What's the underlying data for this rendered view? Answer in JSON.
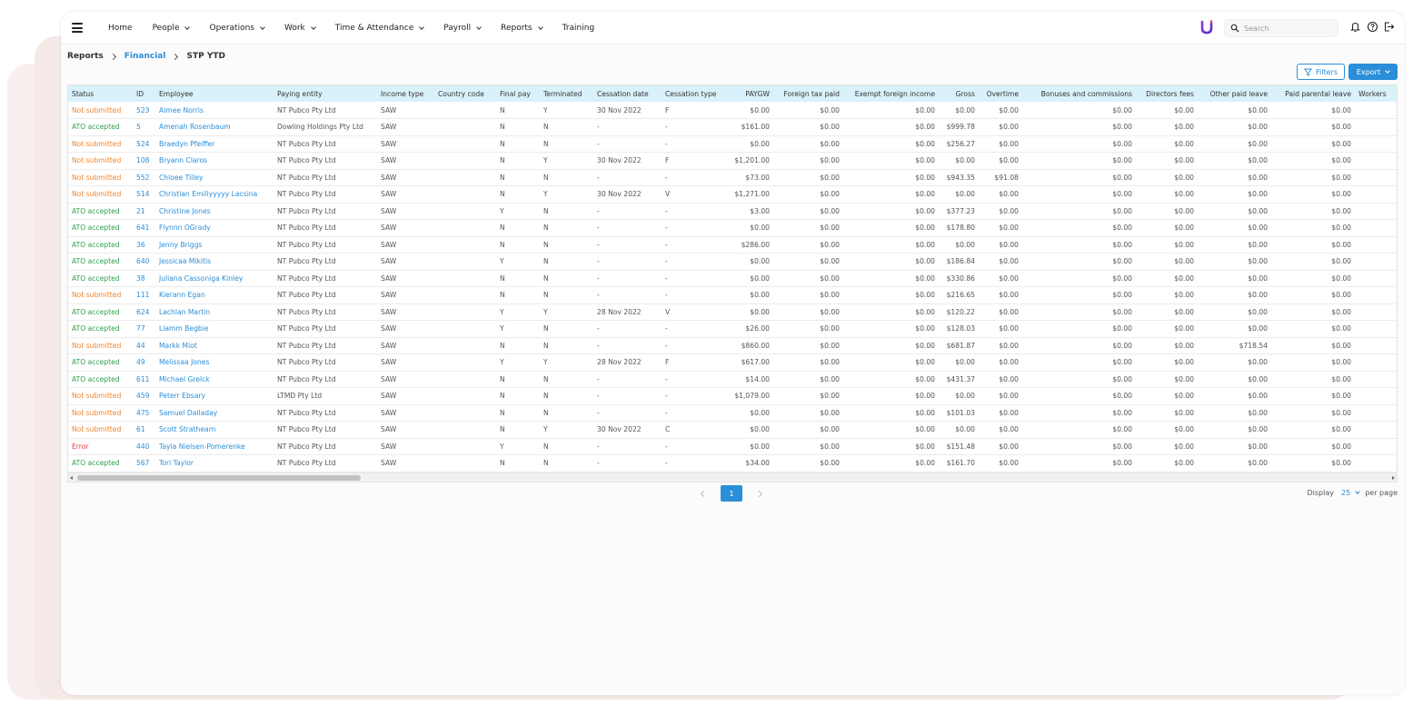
{
  "nav": {
    "menu": [
      {
        "label": "Home",
        "dropdown": false
      },
      {
        "label": "People",
        "dropdown": true
      },
      {
        "label": "Operations",
        "dropdown": true
      },
      {
        "label": "Work",
        "dropdown": true
      },
      {
        "label": "Time & Attendance",
        "dropdown": true
      },
      {
        "label": "Payroll",
        "dropdown": true
      },
      {
        "label": "Reports",
        "dropdown": true
      },
      {
        "label": "Training",
        "dropdown": false
      }
    ],
    "search_placeholder": "Search"
  },
  "breadcrumb": {
    "root": "Reports",
    "section": "Financial",
    "current": "STP YTD"
  },
  "toolbar": {
    "filters_label": "Filters",
    "export_label": "Export"
  },
  "table": {
    "columns": [
      "Status",
      "ID",
      "Employee",
      "Paying entity",
      "Income type",
      "Country code",
      "Final pay",
      "Terminated",
      "Cessation date",
      "Cessation type",
      "PAYGW",
      "Foreign tax paid",
      "Exempt foreign income",
      "Gross",
      "Overtime",
      "Bonuses and commissions",
      "Directors fees",
      "Other paid leave",
      "Paid parental leave",
      "Workers"
    ],
    "rows": [
      [
        "Not submitted",
        "523",
        "Aimee Norris",
        "NT Pubco Pty Ltd",
        "SAW",
        "",
        "N",
        "Y",
        "30 Nov 2022",
        "F",
        "$0.00",
        "$0.00",
        "$0.00",
        "$0.00",
        "$0.00",
        "$0.00",
        "$0.00",
        "$0.00",
        "$0.00",
        ""
      ],
      [
        "ATO accepted",
        "5",
        "Amenah Rosenbaum",
        "Dowling Holdings Pty Ltd",
        "SAW",
        "",
        "N",
        "N",
        "-",
        "-",
        "$161.00",
        "$0.00",
        "$0.00",
        "$999.78",
        "$0.00",
        "$0.00",
        "$0.00",
        "$0.00",
        "$0.00",
        ""
      ],
      [
        "Not submitted",
        "524",
        "Braedyn Pfeiffer",
        "NT Pubco Pty Ltd",
        "SAW",
        "",
        "N",
        "N",
        "-",
        "-",
        "$0.00",
        "$0.00",
        "$0.00",
        "$256.27",
        "$0.00",
        "$0.00",
        "$0.00",
        "$0.00",
        "$0.00",
        ""
      ],
      [
        "Not submitted",
        "108",
        "Bryann Claros",
        "NT Pubco Pty Ltd",
        "SAW",
        "",
        "N",
        "Y",
        "30 Nov 2022",
        "F",
        "$1,201.00",
        "$0.00",
        "$0.00",
        "$0.00",
        "$0.00",
        "$0.00",
        "$0.00",
        "$0.00",
        "$0.00",
        ""
      ],
      [
        "Not submitted",
        "552",
        "Chloee Tilley",
        "NT Pubco Pty Ltd",
        "SAW",
        "",
        "N",
        "N",
        "-",
        "-",
        "$73.00",
        "$0.00",
        "$0.00",
        "$943.35",
        "$91.08",
        "$0.00",
        "$0.00",
        "$0.00",
        "$0.00",
        ""
      ],
      [
        "Not submitted",
        "514",
        "Christian Emillyyyyy Lacsina",
        "NT Pubco Pty Ltd",
        "SAW",
        "",
        "N",
        "Y",
        "30 Nov 2022",
        "V",
        "$1,271.00",
        "$0.00",
        "$0.00",
        "$0.00",
        "$0.00",
        "$0.00",
        "$0.00",
        "$0.00",
        "$0.00",
        ""
      ],
      [
        "ATO accepted",
        "21",
        "Christine Jones",
        "NT Pubco Pty Ltd",
        "SAW",
        "",
        "Y",
        "N",
        "-",
        "-",
        "$3.00",
        "$0.00",
        "$0.00",
        "$377.23",
        "$0.00",
        "$0.00",
        "$0.00",
        "$0.00",
        "$0.00",
        ""
      ],
      [
        "ATO accepted",
        "641",
        "Flynnn OGrady",
        "NT Pubco Pty Ltd",
        "SAW",
        "",
        "N",
        "N",
        "-",
        "-",
        "$0.00",
        "$0.00",
        "$0.00",
        "$178.80",
        "$0.00",
        "$0.00",
        "$0.00",
        "$0.00",
        "$0.00",
        ""
      ],
      [
        "ATO accepted",
        "36",
        "Jenny Briggs",
        "NT Pubco Pty Ltd",
        "SAW",
        "",
        "N",
        "N",
        "-",
        "-",
        "$286.00",
        "$0.00",
        "$0.00",
        "$0.00",
        "$0.00",
        "$0.00",
        "$0.00",
        "$0.00",
        "$0.00",
        ""
      ],
      [
        "ATO accepted",
        "640",
        "Jessicaa Mikitis",
        "NT Pubco Pty Ltd",
        "SAW",
        "",
        "Y",
        "N",
        "-",
        "-",
        "$0.00",
        "$0.00",
        "$0.00",
        "$186.84",
        "$0.00",
        "$0.00",
        "$0.00",
        "$0.00",
        "$0.00",
        ""
      ],
      [
        "ATO accepted",
        "38",
        "Juliana Cassoniga Kinley",
        "NT Pubco Pty Ltd",
        "SAW",
        "",
        "N",
        "N",
        "-",
        "-",
        "$0.00",
        "$0.00",
        "$0.00",
        "$330.86",
        "$0.00",
        "$0.00",
        "$0.00",
        "$0.00",
        "$0.00",
        ""
      ],
      [
        "Not submitted",
        "111",
        "Kierann Egan",
        "NT Pubco Pty Ltd",
        "SAW",
        "",
        "N",
        "N",
        "-",
        "-",
        "$0.00",
        "$0.00",
        "$0.00",
        "$216.65",
        "$0.00",
        "$0.00",
        "$0.00",
        "$0.00",
        "$0.00",
        ""
      ],
      [
        "ATO accepted",
        "624",
        "Lachlan Martin",
        "NT Pubco Pty Ltd",
        "SAW",
        "",
        "Y",
        "Y",
        "28 Nov 2022",
        "V",
        "$0.00",
        "$0.00",
        "$0.00",
        "$120.22",
        "$0.00",
        "$0.00",
        "$0.00",
        "$0.00",
        "$0.00",
        ""
      ],
      [
        "ATO accepted",
        "77",
        "Liamm Begbie",
        "NT Pubco Pty Ltd",
        "SAW",
        "",
        "Y",
        "N",
        "-",
        "-",
        "$26.00",
        "$0.00",
        "$0.00",
        "$128.03",
        "$0.00",
        "$0.00",
        "$0.00",
        "$0.00",
        "$0.00",
        ""
      ],
      [
        "Not submitted",
        "44",
        "Markk Miot",
        "NT Pubco Pty Ltd",
        "SAW",
        "",
        "N",
        "N",
        "-",
        "-",
        "$860.00",
        "$0.00",
        "$0.00",
        "$681.87",
        "$0.00",
        "$0.00",
        "$0.00",
        "$718.54",
        "$0.00",
        ""
      ],
      [
        "ATO accepted",
        "49",
        "Melissaa Jones",
        "NT Pubco Pty Ltd",
        "SAW",
        "",
        "Y",
        "Y",
        "28 Nov 2022",
        "F",
        "$617.00",
        "$0.00",
        "$0.00",
        "$0.00",
        "$0.00",
        "$0.00",
        "$0.00",
        "$0.00",
        "$0.00",
        ""
      ],
      [
        "ATO accepted",
        "611",
        "Michael Grelck",
        "NT Pubco Pty Ltd",
        "SAW",
        "",
        "N",
        "N",
        "-",
        "-",
        "$14.00",
        "$0.00",
        "$0.00",
        "$431.37",
        "$0.00",
        "$0.00",
        "$0.00",
        "$0.00",
        "$0.00",
        ""
      ],
      [
        "Not submitted",
        "459",
        "Peterr Ebsary",
        "LTMD Pty Ltd",
        "SAW",
        "",
        "N",
        "N",
        "-",
        "-",
        "$1,079.00",
        "$0.00",
        "$0.00",
        "$0.00",
        "$0.00",
        "$0.00",
        "$0.00",
        "$0.00",
        "$0.00",
        ""
      ],
      [
        "Not submitted",
        "475",
        "Samuel Dalladay",
        "NT Pubco Pty Ltd",
        "SAW",
        "",
        "N",
        "N",
        "-",
        "-",
        "$0.00",
        "$0.00",
        "$0.00",
        "$101.03",
        "$0.00",
        "$0.00",
        "$0.00",
        "$0.00",
        "$0.00",
        ""
      ],
      [
        "Not submitted",
        "61",
        "Scott Strathearn",
        "NT Pubco Pty Ltd",
        "SAW",
        "",
        "N",
        "Y",
        "30 Nov 2022",
        "C",
        "$0.00",
        "$0.00",
        "$0.00",
        "$0.00",
        "$0.00",
        "$0.00",
        "$0.00",
        "$0.00",
        "$0.00",
        ""
      ],
      [
        "Error",
        "440",
        "Tayla Nielsen-Pomerenke",
        "NT Pubco Pty Ltd",
        "SAW",
        "",
        "Y",
        "N",
        "-",
        "-",
        "$0.00",
        "$0.00",
        "$0.00",
        "$151.48",
        "$0.00",
        "$0.00",
        "$0.00",
        "$0.00",
        "$0.00",
        ""
      ],
      [
        "ATO accepted",
        "567",
        "Tori Taylor",
        "NT Pubco Pty Ltd",
        "SAW",
        "",
        "N",
        "N",
        "-",
        "-",
        "$34.00",
        "$0.00",
        "$0.00",
        "$161.70",
        "$0.00",
        "$0.00",
        "$0.00",
        "$0.00",
        "$0.00",
        ""
      ]
    ]
  },
  "pagination": {
    "current_page": "1",
    "display_label": "Display",
    "per_page_value": "25",
    "per_page_label": "per page"
  },
  "colors": {
    "accent": "#2b8ed8",
    "status_not_submitted": "#f0862f",
    "status_ato_accepted": "#2ea14f",
    "status_error": "#e6394b",
    "header_bg": "#d9f1fa"
  }
}
